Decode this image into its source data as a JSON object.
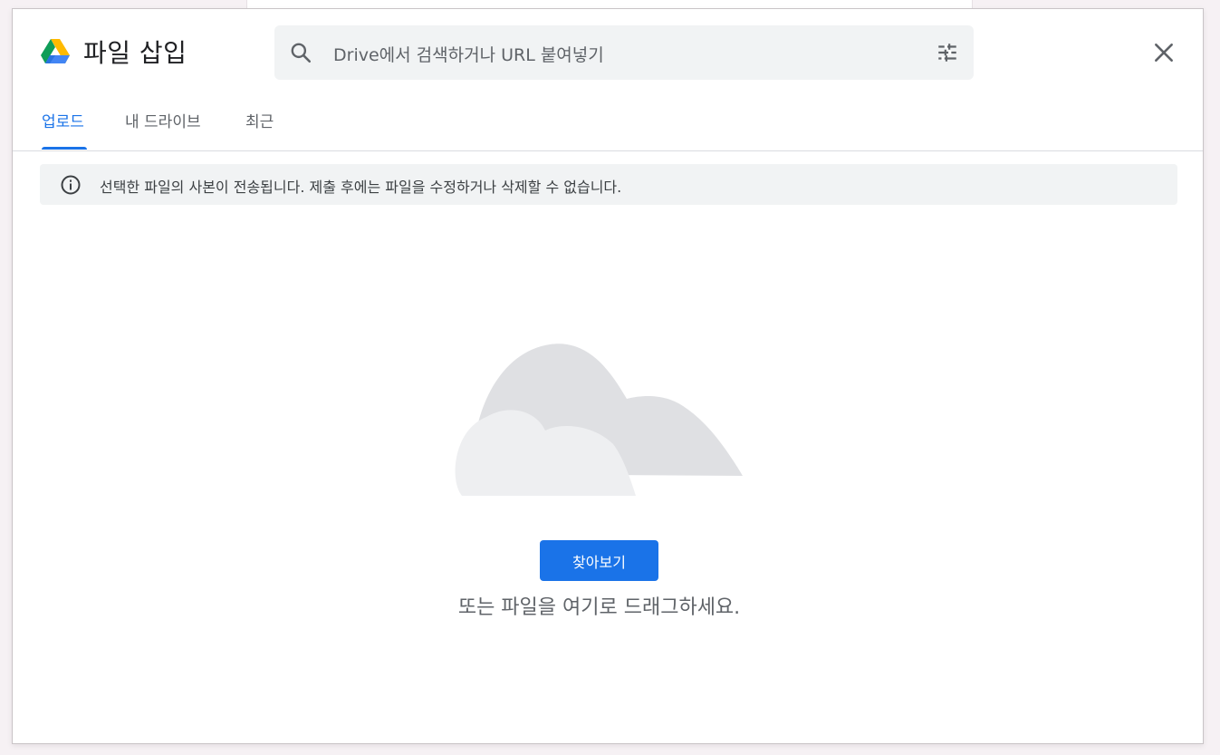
{
  "dialog": {
    "title": "파일 삽입",
    "logo_icon": "google-drive-icon",
    "close_icon": "close-icon"
  },
  "search": {
    "placeholder": "Drive에서 검색하거나 URL 붙여넣기",
    "search_icon": "search-icon",
    "options_icon": "tune-icon"
  },
  "tabs": [
    {
      "label": "업로드",
      "active": true
    },
    {
      "label": "내 드라이브",
      "active": false
    },
    {
      "label": "최근",
      "active": false
    }
  ],
  "notice": {
    "icon": "info-icon",
    "text": "선택한 파일의 사본이 전송됩니다. 제출 후에는 파일을 수정하거나 삭제할 수 없습니다."
  },
  "upload": {
    "illustration": "cloud-icon",
    "browse_label": "찾아보기",
    "drag_text": "또는 파일을 여기로 드래그하세요."
  },
  "colors": {
    "accent": "#1a73e8",
    "surface": "#f1f3f4",
    "text_secondary": "#5f6368"
  }
}
